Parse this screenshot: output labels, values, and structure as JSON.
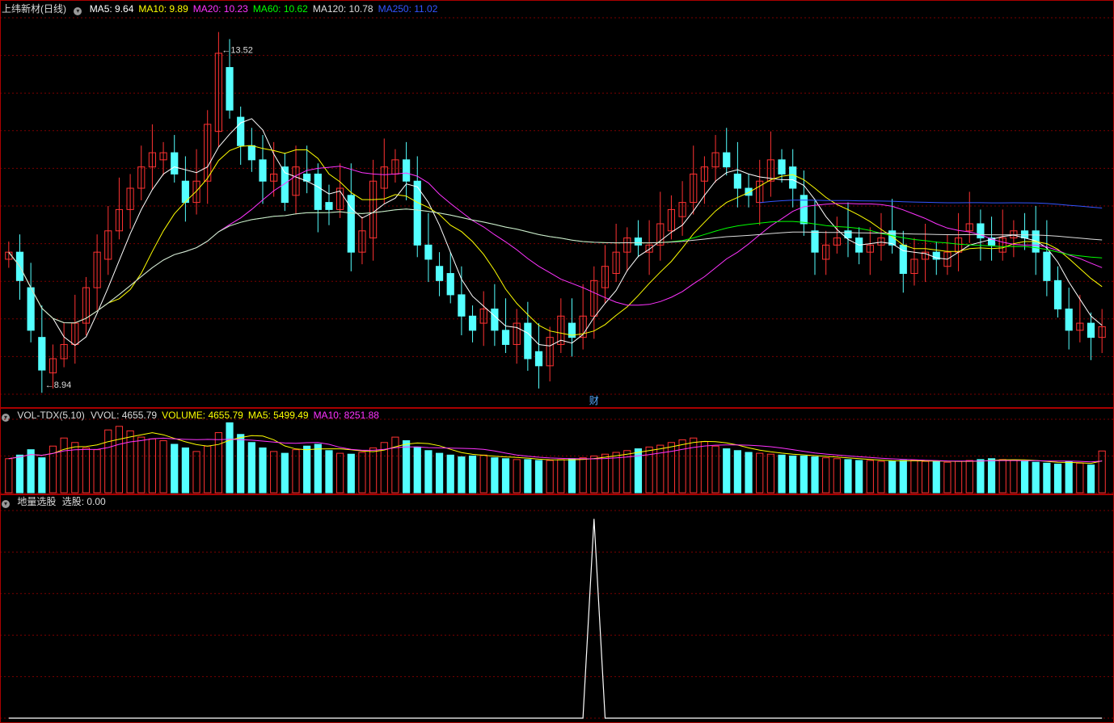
{
  "main": {
    "title": "上纬新材(日线)",
    "ma": [
      {
        "label": "MA5: 9.64",
        "color": "#ffffff"
      },
      {
        "label": "MA10: 9.89",
        "color": "#ffff00"
      },
      {
        "label": "MA20: 10.23",
        "color": "#ff33ff"
      },
      {
        "label": "MA60: 10.62",
        "color": "#00ff00"
      },
      {
        "label": "MA120: 10.78",
        "color": "#dddddd"
      },
      {
        "label": "MA250: 11.02",
        "color": "#3355ff"
      }
    ],
    "high_label": "13.52",
    "low_label": "8.94",
    "fin_mark": "财"
  },
  "volume": {
    "name": "VOL-TDX(5,10)",
    "items": [
      {
        "label": "VVOL: 4655.79",
        "color": "#dddddd"
      },
      {
        "label": "VOLUME: 4655.79",
        "color": "#ffff00"
      },
      {
        "label": "MA5: 5499.49",
        "color": "#ffff00"
      },
      {
        "label": "MA10: 8251.88",
        "color": "#ff33ff"
      }
    ]
  },
  "indicator": {
    "name": "地量选股",
    "value_label": "选股: 0.00"
  },
  "colors": {
    "up": "#ff3232",
    "down": "#54ffff",
    "grid": "#7a0000",
    "border": "#aa0000"
  },
  "chart_data": [
    {
      "type": "candlestick",
      "title": "上纬新材(日线)",
      "series_open": [
        10.5,
        10.6,
        10.1,
        9.4,
        8.9,
        9.1,
        9.3,
        9.6,
        10.1,
        10.5,
        10.9,
        11.2,
        11.5,
        11.8,
        11.9,
        12.0,
        11.6,
        11.3,
        11.6,
        12.3,
        13.2,
        12.5,
        12.1,
        11.9,
        11.6,
        11.8,
        11.4,
        11.7,
        11.7,
        11.3,
        11.2,
        11.4,
        10.6,
        10.8,
        11.5,
        11.7,
        11.9,
        11.6,
        10.7,
        10.4,
        10.3,
        10.0,
        9.7,
        9.6,
        9.8,
        9.5,
        9.3,
        9.6,
        9.2,
        9.0,
        9.3,
        9.6,
        9.4,
        9.7,
        10.1,
        10.3,
        10.6,
        10.8,
        10.6,
        10.7,
        10.9,
        11.1,
        11.3,
        11.6,
        11.8,
        12.0,
        11.7,
        11.5,
        11.3,
        11.6,
        11.9,
        11.8,
        11.4,
        10.9,
        10.5,
        10.7,
        10.9,
        10.8,
        10.6,
        10.7,
        10.9,
        10.7,
        10.3,
        10.5,
        10.6,
        10.4,
        10.6,
        10.9,
        11.0,
        10.8,
        10.6,
        10.8,
        10.9,
        10.9,
        10.6,
        10.2,
        9.8,
        9.5,
        9.6,
        9.4
      ],
      "series_close": [
        10.6,
        10.2,
        9.5,
        8.94,
        9.1,
        9.3,
        9.6,
        10.1,
        10.6,
        10.9,
        11.2,
        11.5,
        11.8,
        12.0,
        12.0,
        11.7,
        11.3,
        11.6,
        12.4,
        13.4,
        12.6,
        12.1,
        11.9,
        11.6,
        11.7,
        11.3,
        11.8,
        11.6,
        11.2,
        11.2,
        11.5,
        10.6,
        10.9,
        11.6,
        11.8,
        11.9,
        11.6,
        10.7,
        10.5,
        10.2,
        10.0,
        9.7,
        9.5,
        9.8,
        9.5,
        9.3,
        9.6,
        9.1,
        9.0,
        9.4,
        9.7,
        9.4,
        9.7,
        10.2,
        10.4,
        10.6,
        10.8,
        10.7,
        10.7,
        11.0,
        11.2,
        11.3,
        11.7,
        11.8,
        12.0,
        11.8,
        11.5,
        11.4,
        11.6,
        11.9,
        11.7,
        11.5,
        11.0,
        10.6,
        10.7,
        10.8,
        10.8,
        10.6,
        10.7,
        10.8,
        10.7,
        10.3,
        10.5,
        10.6,
        10.5,
        10.6,
        10.8,
        11.0,
        10.8,
        10.7,
        10.8,
        10.9,
        10.8,
        10.6,
        10.2,
        9.8,
        9.5,
        9.6,
        9.4,
        9.55
      ],
      "ylim": [
        8.6,
        13.9
      ],
      "high": 13.52,
      "low": 8.94
    },
    {
      "type": "bar",
      "title": "VOL-TDX(5,10)",
      "values": [
        3800,
        4200,
        4800,
        3900,
        5200,
        6100,
        5600,
        5000,
        4800,
        7000,
        7400,
        6900,
        6200,
        6000,
        5800,
        5400,
        5000,
        4600,
        5200,
        6700,
        7800,
        6500,
        5600,
        5000,
        4600,
        4400,
        4800,
        5200,
        5400,
        4700,
        4400,
        4300,
        4500,
        5000,
        5600,
        6200,
        5800,
        5100,
        4700,
        4400,
        4200,
        4000,
        4100,
        4200,
        3900,
        3800,
        3700,
        3700,
        3600,
        3600,
        3700,
        3800,
        3900,
        4100,
        4300,
        4500,
        4700,
        4900,
        5100,
        5300,
        5600,
        5900,
        6100,
        5700,
        5200,
        4900,
        4700,
        4500,
        4400,
        4300,
        4200,
        4100,
        4100,
        4000,
        3900,
        3800,
        3700,
        3600,
        3600,
        3500,
        3500,
        3600,
        3600,
        3500,
        3500,
        3400,
        3500,
        3600,
        3700,
        3800,
        3700,
        3600,
        3500,
        3400,
        3300,
        3200,
        3500,
        3300,
        3100,
        4655.79
      ]
    },
    {
      "type": "line",
      "title": "地量选股",
      "values": [
        0,
        0,
        0,
        0,
        0,
        0,
        0,
        0,
        0,
        0,
        0,
        0,
        0,
        0,
        0,
        0,
        0,
        0,
        0,
        0,
        0,
        0,
        0,
        0,
        0,
        0,
        0,
        0,
        0,
        0,
        0,
        0,
        0,
        0,
        0,
        0,
        0,
        0,
        0,
        0,
        0,
        0,
        0,
        0,
        0,
        0,
        0,
        0,
        0,
        0,
        0,
        0,
        0,
        1,
        0,
        0,
        0,
        0,
        0,
        0,
        0,
        0,
        0,
        0,
        0,
        0,
        0,
        0,
        0,
        0,
        0,
        0,
        0,
        0,
        0,
        0,
        0,
        0,
        0,
        0,
        0,
        0,
        0,
        0,
        0,
        0,
        0,
        0,
        0,
        0,
        0,
        0,
        0,
        0,
        0,
        0,
        0,
        0,
        0,
        0
      ],
      "ylim": [
        0,
        1.05
      ]
    }
  ]
}
